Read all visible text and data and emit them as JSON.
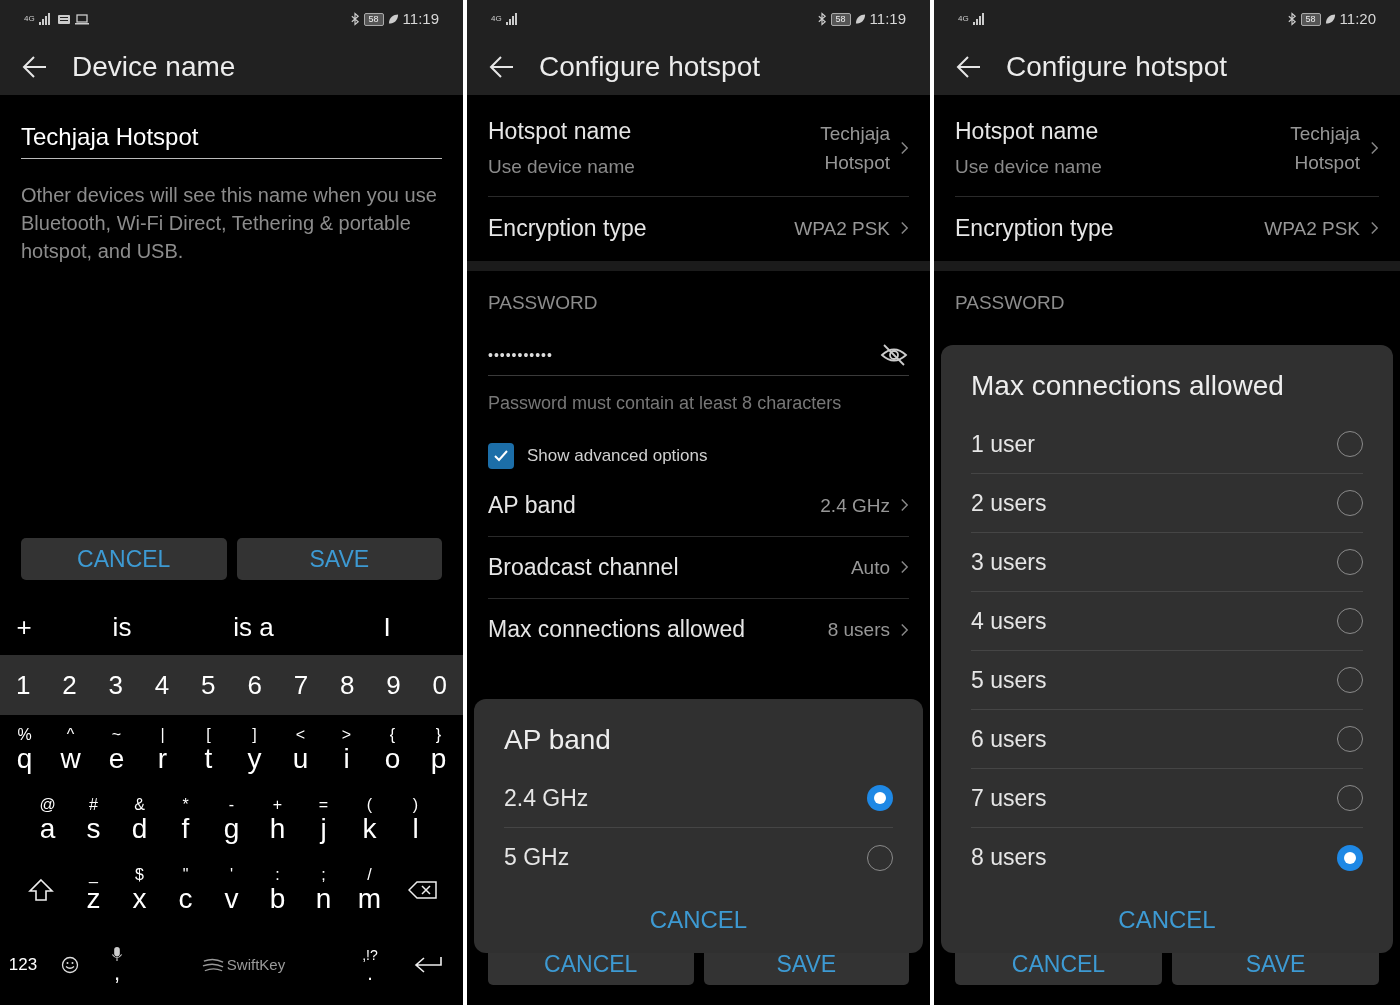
{
  "screens": [
    {
      "kind": "device_name",
      "status_bar": {
        "network": "4G",
        "battery": "58",
        "time": "11:19"
      },
      "title": "Device name",
      "name_field": {
        "value": "Techjaja Hotspot"
      },
      "description": "Other devices will see this name when you use Bluetooth, Wi-Fi Direct, Tethering & portable hotspot, and USB.",
      "buttons": [
        "CANCEL",
        "SAVE"
      ],
      "keyboard": {
        "suggestions": [
          "+",
          "is",
          "is a",
          "I"
        ],
        "number_row": [
          "1",
          "2",
          "3",
          "4",
          "5",
          "6",
          "7",
          "8",
          "9",
          "0"
        ],
        "letter_rows": [
          [
            {
              "key": "q",
              "alt": "%"
            },
            {
              "key": "w",
              "alt": "^"
            },
            {
              "key": "e",
              "alt": "~"
            },
            {
              "key": "r",
              "alt": "|"
            },
            {
              "key": "t",
              "alt": "["
            },
            {
              "key": "y",
              "alt": "]"
            },
            {
              "key": "u",
              "alt": "<"
            },
            {
              "key": "i",
              "alt": ">"
            },
            {
              "key": "o",
              "alt": "{"
            },
            {
              "key": "p",
              "alt": "}"
            }
          ],
          [
            {
              "key": "a",
              "alt": "@"
            },
            {
              "key": "s",
              "alt": "#"
            },
            {
              "key": "d",
              "alt": "&"
            },
            {
              "key": "f",
              "alt": "*"
            },
            {
              "key": "g",
              "alt": "-"
            },
            {
              "key": "h",
              "alt": "+"
            },
            {
              "key": "j",
              "alt": "="
            },
            {
              "key": "k",
              "alt": "("
            },
            {
              "key": "l",
              "alt": ")"
            }
          ],
          [
            {
              "key": "z",
              "alt": "_"
            },
            {
              "key": "x",
              "alt": "$"
            },
            {
              "key": "c",
              "alt": "\""
            },
            {
              "key": "v",
              "alt": "'"
            },
            {
              "key": "b",
              "alt": ":"
            },
            {
              "key": "n",
              "alt": ";"
            },
            {
              "key": "m",
              "alt": "/"
            }
          ]
        ],
        "symbols_key": "123",
        "comma_key": ",",
        "space_label": "SwiftKey",
        "period_key": {
          "key": ".",
          "alt": ",!?"
        }
      }
    },
    {
      "kind": "settings",
      "status_bar": {
        "network": "4G",
        "battery": "58",
        "time": "11:19"
      },
      "title": "Configure hotspot",
      "items": [
        {
          "kind": "row",
          "label": "Hotspot name",
          "sublabel": "Use device name",
          "value": "Techjaja Hotspot"
        },
        {
          "kind": "row",
          "label": "Encryption type",
          "value": "WPA2 PSK"
        },
        {
          "kind": "gap"
        },
        {
          "kind": "section",
          "label": "PASSWORD"
        },
        {
          "kind": "password",
          "value": "•••••••••••"
        },
        {
          "kind": "hint",
          "label": "Password must contain at least 8 characters"
        },
        {
          "kind": "checkbox",
          "label": "Show advanced options",
          "checked": true
        },
        {
          "kind": "row",
          "label": "AP band",
          "value": "2.4 GHz"
        },
        {
          "kind": "row",
          "label": "Broadcast channel",
          "value": "Auto"
        },
        {
          "kind": "row",
          "label": "Max connections allowed",
          "value": "8 users"
        }
      ],
      "buttons": [
        "CANCEL",
        "SAVE"
      ],
      "dialog": {
        "title": "AP band",
        "options": [
          {
            "label": "2.4 GHz",
            "selected": true
          },
          {
            "label": "5 GHz",
            "selected": false
          }
        ],
        "cancel": "CANCEL"
      }
    },
    {
      "kind": "settings",
      "status_bar": {
        "network": "4G",
        "battery": "58",
        "time": "11:20"
      },
      "title": "Configure hotspot",
      "items": [
        {
          "kind": "row",
          "label": "Hotspot name",
          "sublabel": "Use device name",
          "value": "Techjaja Hotspot"
        },
        {
          "kind": "row",
          "label": "Encryption type",
          "value": "WPA2 PSK"
        },
        {
          "kind": "gap"
        },
        {
          "kind": "section",
          "label": "PASSWORD"
        }
      ],
      "buttons": [
        "CANCEL",
        "SAVE"
      ],
      "dialog": {
        "title": "Max connections allowed",
        "options": [
          {
            "label": "1 user",
            "selected": false
          },
          {
            "label": "2 users",
            "selected": false
          },
          {
            "label": "3 users",
            "selected": false
          },
          {
            "label": "4 users",
            "selected": false
          },
          {
            "label": "5 users",
            "selected": false
          },
          {
            "label": "6 users",
            "selected": false
          },
          {
            "label": "7 users",
            "selected": false
          },
          {
            "label": "8 users",
            "selected": true
          }
        ],
        "cancel": "CANCEL"
      }
    }
  ]
}
